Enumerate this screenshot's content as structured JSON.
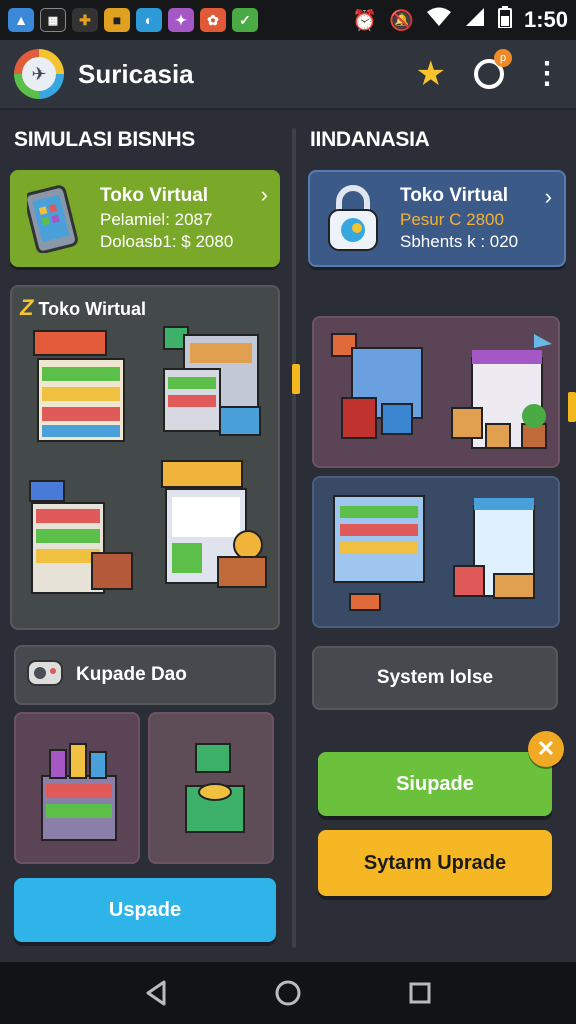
{
  "status_bar": {
    "time": "1:50",
    "notif_icons": [
      "image-icon",
      "qr-icon",
      "puzzle-icon",
      "note-icon",
      "blue-app-icon",
      "purple-app-icon",
      "shield-red-icon",
      "shield-green-icon"
    ],
    "notif_colors": [
      "#3a88d8",
      "#222",
      "#e0a020",
      "#e0a020",
      "#2d9ad8",
      "#a657c6",
      "#e05a38",
      "#4aaa44"
    ]
  },
  "app_bar": {
    "title": "Suricasia",
    "actions": [
      "star-icon",
      "chat-icon",
      "more-icon"
    ],
    "chat_badge": "p"
  },
  "left": {
    "section_title": "SIMULASI BISNHS",
    "featured": {
      "name": "Toko Virtual",
      "line1": "Pelamiel: 2087",
      "line2": "Doloasb1: $ 2080",
      "color": "#7aa92a"
    },
    "store_panel": {
      "title_mark": "Z",
      "title": "Toko Wirtual"
    },
    "upgrade_label": "Kupade Dao",
    "main_button": "Uspade",
    "main_button_color": "#2fb4ea"
  },
  "right": {
    "section_title": "IINDANASIA",
    "featured": {
      "name": "Toko Virtual",
      "line1": "Pesur C 2800",
      "line2": "Sbhents k : 020",
      "color": "#3c5a88",
      "line1_color": "#f2b23a"
    },
    "system_label": "System Iolse",
    "button_green": "Siupade",
    "button_green_color": "#6cc13c",
    "button_yellow": "Sytarm Uprade",
    "button_yellow_color": "#f5b724",
    "close_symbol": "✕"
  }
}
